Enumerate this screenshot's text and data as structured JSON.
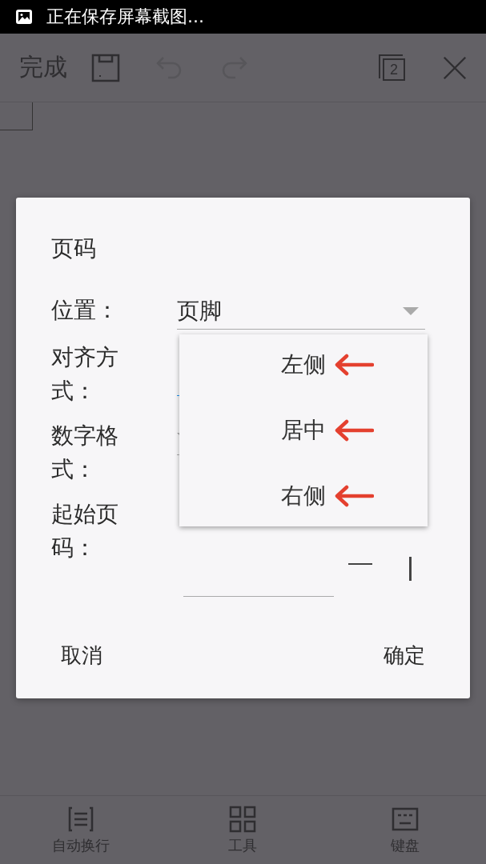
{
  "status_bar": {
    "notification": "正在保存屏幕截图..."
  },
  "toolbar": {
    "done": "完成",
    "buttons": [
      {
        "kind": "save",
        "disabled": false
      },
      {
        "kind": "undo",
        "disabled": true
      },
      {
        "kind": "redo",
        "disabled": true
      },
      {
        "kind": "pages",
        "badge": "2",
        "disabled": false
      },
      {
        "kind": "close",
        "disabled": false
      }
    ]
  },
  "dialog": {
    "title": "页码",
    "fields": [
      {
        "label": "位置：",
        "value": "页脚",
        "kind": "dropdown"
      },
      {
        "label": "对齐方式：",
        "kind": "dropdown_open"
      },
      {
        "label": "数字格式：",
        "kind": "dropdown"
      },
      {
        "label": "起始页码：",
        "kind": "stepper"
      }
    ],
    "menu": {
      "options": [
        {
          "label": "左侧",
          "annotated": true
        },
        {
          "label": "居中",
          "annotated": true
        },
        {
          "label": "右侧",
          "annotated": true
        }
      ]
    },
    "buttons": [
      "取消",
      "确定"
    ]
  },
  "bottom_bar": [
    {
      "label": "自动换行",
      "kind": "wrap"
    },
    {
      "label": "工具",
      "kind": "tools"
    },
    {
      "label": "键盘",
      "kind": "keyboard"
    }
  ]
}
